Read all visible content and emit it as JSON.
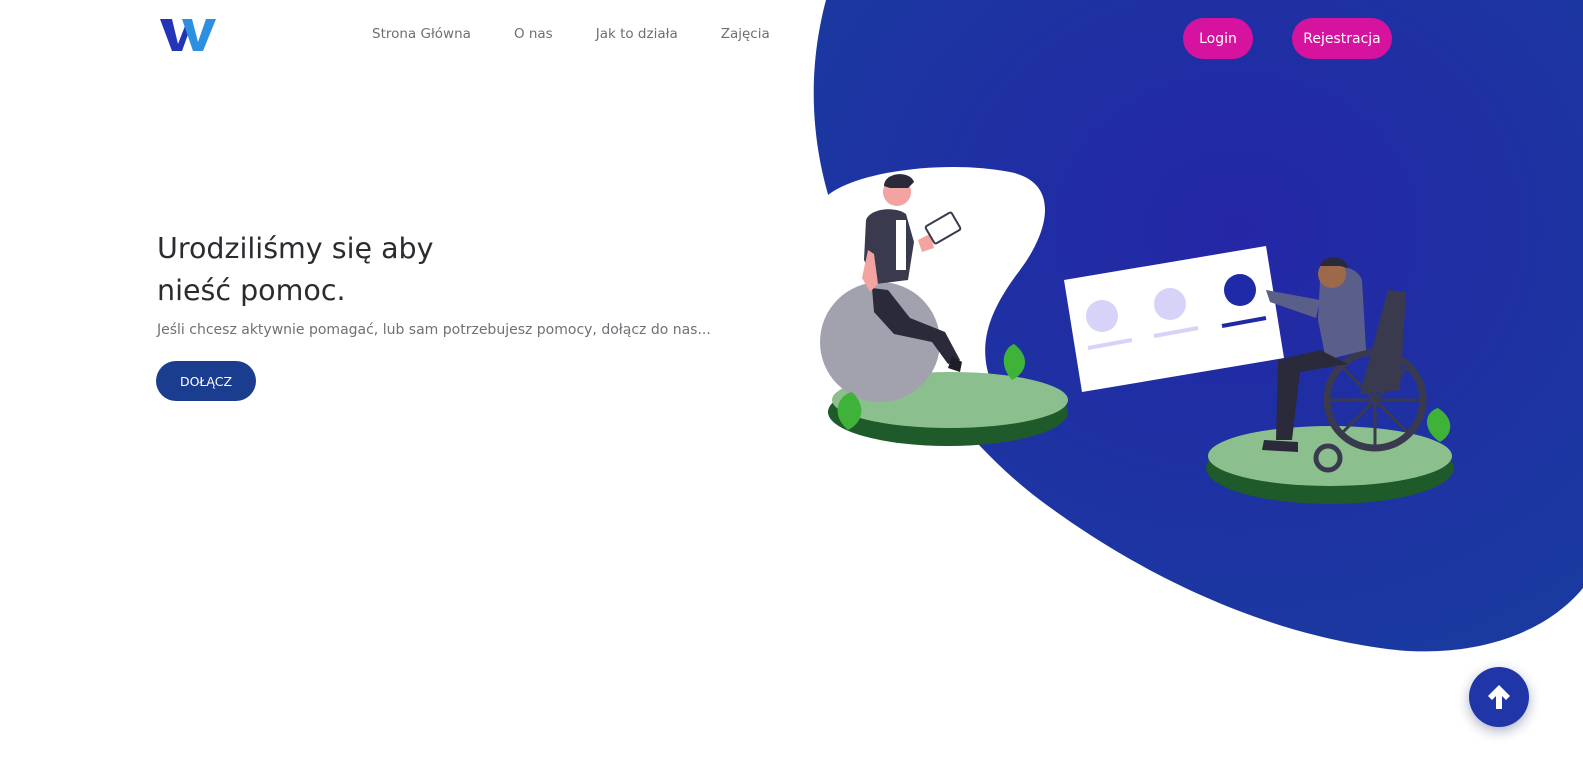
{
  "brand": {
    "logo_icon": "w-logo-icon"
  },
  "nav": {
    "items": [
      {
        "label": "Strona Główna"
      },
      {
        "label": "O nas"
      },
      {
        "label": "Jak to działa"
      },
      {
        "label": "Zajęcia"
      }
    ]
  },
  "auth": {
    "login_label": "Login",
    "register_label": "Rejestracja"
  },
  "hero": {
    "title_line1": "Urodziliśmy się aby",
    "title_line2": "nieść pomoc.",
    "subtitle": "Jeśli chcesz aktywnie pomagać, lub sam potrzebujesz pomocy, dołącz do nas...",
    "cta_label": "DOŁĄCZ"
  },
  "scroll_top": {
    "icon": "arrow-up-icon"
  },
  "colors": {
    "accent_pink": "#d5139e",
    "blob_blue": "#1c34a6",
    "cta_blue": "#1a3d8f"
  }
}
